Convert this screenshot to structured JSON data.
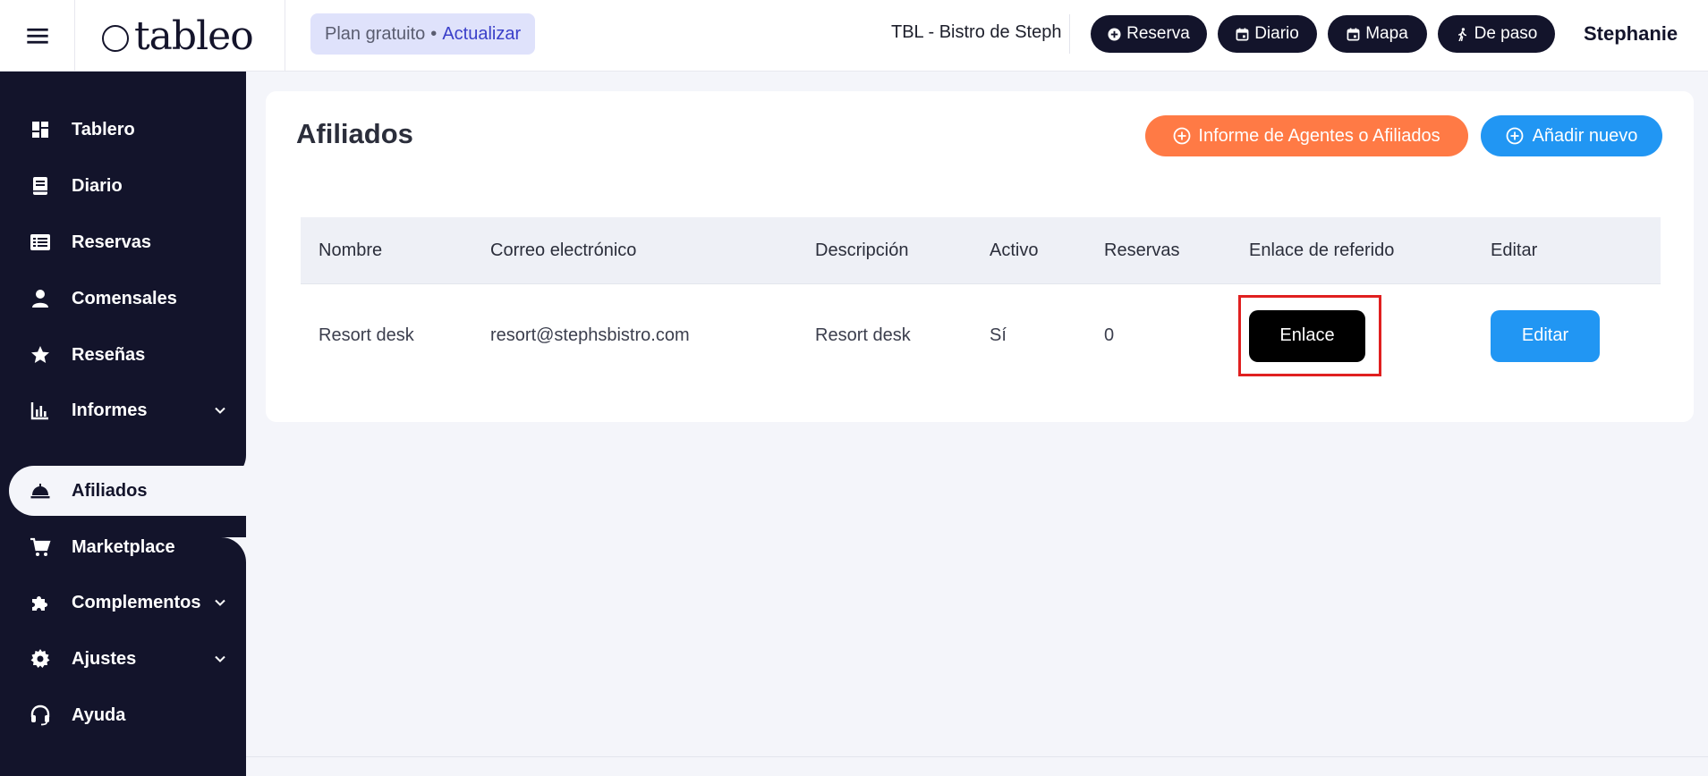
{
  "header": {
    "logo_text": "tableo",
    "plan_label": "Plan gratuito",
    "plan_separator": "•",
    "upgrade_label": "Actualizar",
    "restaurant_name": "TBL - Bistro de Steph",
    "quick_actions": [
      {
        "label": "Reserva",
        "icon": "plus-circle-icon"
      },
      {
        "label": "Diario",
        "icon": "calendar-icon"
      },
      {
        "label": "Mapa",
        "icon": "calendar-icon"
      },
      {
        "label": "De paso",
        "icon": "walk-icon"
      }
    ],
    "user_name": "Stephanie"
  },
  "sidebar": {
    "items": [
      {
        "label": "Tablero",
        "icon": "dashboard-icon"
      },
      {
        "label": "Diario",
        "icon": "book-icon"
      },
      {
        "label": "Reservas",
        "icon": "list-icon"
      },
      {
        "label": "Comensales",
        "icon": "person-icon"
      },
      {
        "label": "Reseñas",
        "icon": "star-icon"
      },
      {
        "label": "Informes",
        "icon": "bar-chart-icon",
        "expandable": true
      },
      {
        "label": "Afiliados",
        "icon": "bell-icon",
        "active": true
      },
      {
        "label": "Marketplace",
        "icon": "cart-icon"
      },
      {
        "label": "Complementos",
        "icon": "puzzle-icon",
        "expandable": true
      },
      {
        "label": "Ajustes",
        "icon": "gear-icon",
        "expandable": true
      },
      {
        "label": "Ayuda",
        "icon": "headset-icon"
      }
    ]
  },
  "main": {
    "title": "Afiliados",
    "report_button": "Informe de Agentes o Afiliados",
    "add_button": "Añadir nuevo",
    "table": {
      "columns": [
        "Nombre",
        "Correo electrónico",
        "Descripción",
        "Activo",
        "Reservas",
        "Enlace de referido",
        "Editar"
      ],
      "rows": [
        {
          "nombre": "Resort desk",
          "correo": "resort@stephsbistro.com",
          "descripcion": "Resort desk",
          "activo": "Sí",
          "reservas": "0",
          "enlace_label": "Enlace",
          "editar_label": "Editar"
        }
      ]
    }
  },
  "colors": {
    "sidebar_bg": "#13142b",
    "accent_orange": "#ff7a45",
    "accent_blue": "#2196f3",
    "highlight_red": "#e02020"
  }
}
